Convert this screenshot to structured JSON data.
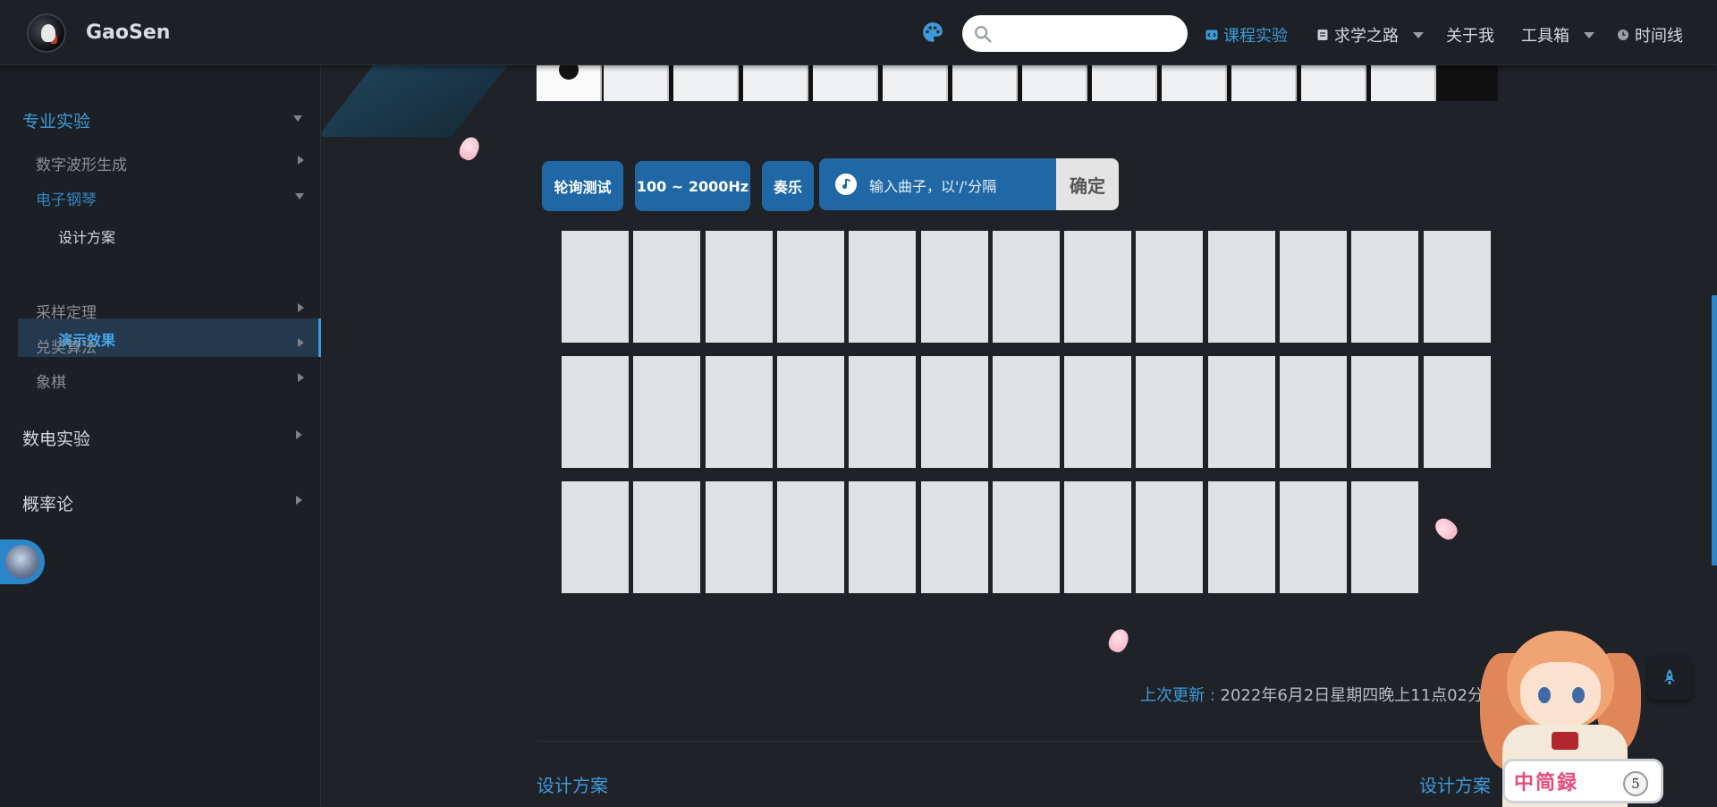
{
  "navbar": {
    "site_name": "GaoSen",
    "search": {
      "placeholder": "",
      "value": ""
    },
    "items": [
      {
        "label": "课程实验",
        "icon": "code-icon",
        "active": true
      },
      {
        "label": "求学之路",
        "icon": "book-icon",
        "dropdown": true
      },
      {
        "label": "关于我"
      },
      {
        "label": "工具箱",
        "dropdown": true
      },
      {
        "label": "时间线",
        "icon": "clock-icon"
      }
    ],
    "accent_color": "#3d9bdc"
  },
  "sidebar": {
    "groups": [
      {
        "label": "专业实验",
        "active": true,
        "expanded": true,
        "children": [
          {
            "label": "数字波形生成"
          },
          {
            "label": "电子钢琴",
            "active": true,
            "expanded": true,
            "children": [
              {
                "label": "设计方案"
              },
              {
                "label": "演示效果",
                "active": true
              }
            ]
          },
          {
            "label": "采样定理"
          },
          {
            "label": "兑奖算法"
          },
          {
            "label": "象棋"
          }
        ]
      },
      {
        "label": "数电实验"
      },
      {
        "label": "概率论"
      }
    ]
  },
  "controls": {
    "poll_test": "轮询测试",
    "freq_range": "100 ~ 2000Hz",
    "play": "奏乐",
    "tune_input_placeholder": "输入曲子，以'/'分隔",
    "confirm": "确定",
    "button_color": "#1f68a5"
  },
  "piano": {
    "rows": [
      13,
      13,
      12
    ],
    "key_color": "#e0e1e3"
  },
  "footer": {
    "last_updated_label": "上次更新 :",
    "last_updated_value": "2022年6月2日星期四晚上11点02分",
    "prev_link": "设计方案",
    "next_link": "设计方案"
  },
  "mascot": {
    "board_text": "中简録",
    "badge": "5"
  }
}
